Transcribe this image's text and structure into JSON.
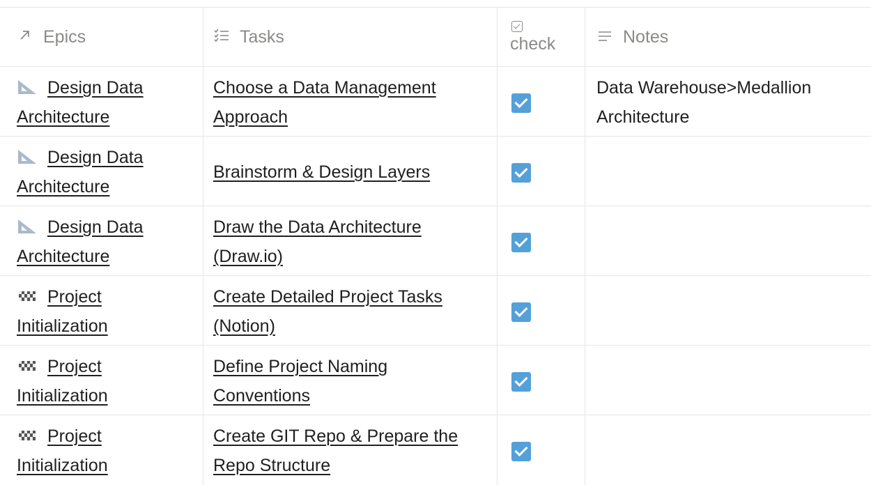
{
  "header": {
    "epics": "Epics",
    "tasks": "Tasks",
    "check": "check",
    "notes": "Notes"
  },
  "icons": {
    "epics": "arrow-up-right-icon",
    "tasks": "checklist-icon",
    "check": "checkbox-icon",
    "notes": "text-lines-icon",
    "design": "triangle-ruler-icon",
    "project": "checkered-flag-icon"
  },
  "colors": {
    "checkbox": "#54a0d8",
    "header_text": "#8a8a88",
    "border": "#e6e6e4"
  },
  "rows": [
    {
      "epic_icon": "design",
      "epic_line1": "Design Data",
      "epic_line2": "Architecture",
      "task": "Choose a Data Management Approach",
      "checked": true,
      "notes": "Data Warehouse>Medallion Architecture"
    },
    {
      "epic_icon": "design",
      "epic_line1": "Design Data",
      "epic_line2": "Architecture",
      "task": "Brainstorm & Design Layers",
      "checked": true,
      "notes": ""
    },
    {
      "epic_icon": "design",
      "epic_line1": "Design Data",
      "epic_line2": "Architecture",
      "task": "Draw the Data Architecture (Draw.io)",
      "checked": true,
      "notes": ""
    },
    {
      "epic_icon": "project",
      "epic_line1": "Project",
      "epic_line2": "Initialization",
      "task": "Create Detailed Project Tasks (Notion)",
      "checked": true,
      "notes": ""
    },
    {
      "epic_icon": "project",
      "epic_line1": "Project",
      "epic_line2": "Initialization",
      "task": "Define Project Naming Conventions",
      "checked": true,
      "notes": ""
    },
    {
      "epic_icon": "project",
      "epic_line1": "Project",
      "epic_line2": "Initialization",
      "task": "Create GIT Repo & Prepare the Repo Structure",
      "checked": true,
      "notes": ""
    }
  ]
}
